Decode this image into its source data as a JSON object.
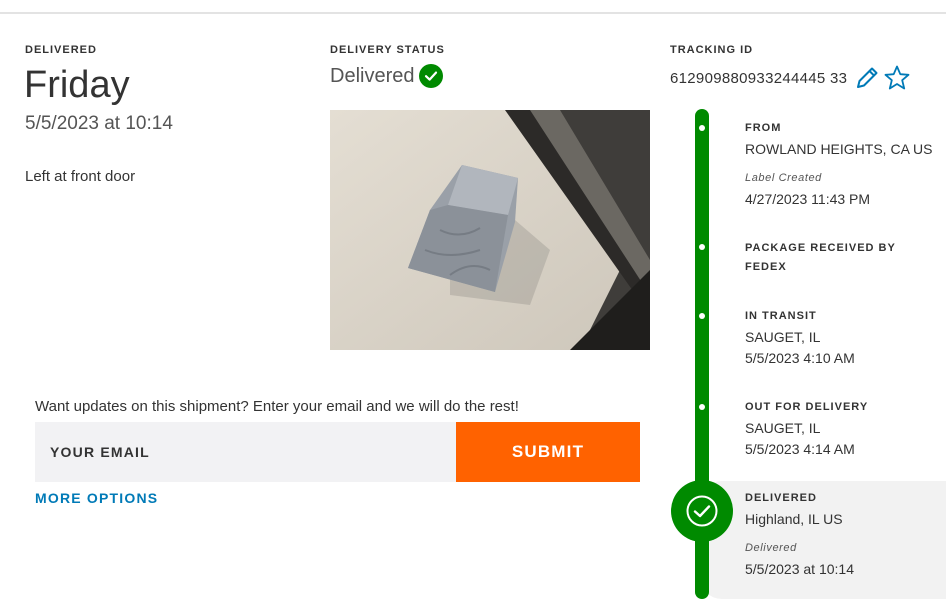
{
  "colors": {
    "accent_orange": "#ff6200",
    "success_green": "#008a00",
    "link_blue": "#007ab7",
    "input_bg": "#f2f2f4"
  },
  "delivered": {
    "label": "DELIVERED",
    "day": "Friday",
    "datetime": "5/5/2023 at 10:14",
    "location_note": "Left at front door"
  },
  "status": {
    "label": "DELIVERY STATUS",
    "value": "Delivered",
    "icon": "check-circle-icon"
  },
  "tracking": {
    "label": "TRACKING ID",
    "number": "612909880933244445 33",
    "edit_icon": "pencil-icon",
    "favorite_icon": "star-icon"
  },
  "signup": {
    "prompt": "Want updates on this shipment? Enter your email and we will do the rest!",
    "email_placeholder": "YOUR EMAIL",
    "submit_label": "SUBMIT",
    "more_options": "MORE OPTIONS"
  },
  "timeline": {
    "from_label": "FROM",
    "from_location": "ROWLAND HEIGHTS, CA US",
    "label_created_caption": "Label Created",
    "label_created_time": "4/27/2023 11:43 PM",
    "received_line1": "PACKAGE RECEIVED BY",
    "received_line2": "FEDEX",
    "transit_label": "IN TRANSIT",
    "transit_location": "SAUGET, IL",
    "transit_time": "5/5/2023 4:10 AM",
    "ofd_label": "OUT FOR DELIVERY",
    "ofd_location": "SAUGET, IL",
    "ofd_time": "5/5/2023 4:14 AM",
    "delivered_label": "DELIVERED",
    "delivered_location": "Highland, IL US",
    "delivered_caption": "Delivered",
    "delivered_time": "5/5/2023 at 10:14"
  }
}
